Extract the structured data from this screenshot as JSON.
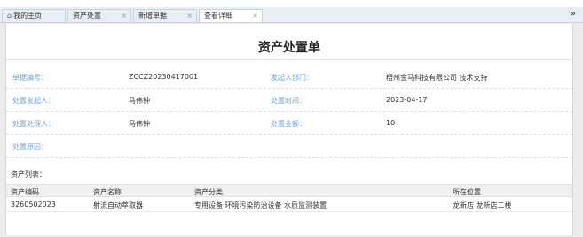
{
  "tabs": [
    {
      "label": "我的主页",
      "icon": "home-icon",
      "closable": false,
      "active": false
    },
    {
      "label": "资产处置",
      "closable": true,
      "active": false
    },
    {
      "label": "新增单据",
      "closable": true,
      "active": false
    },
    {
      "label": "查看详细",
      "closable": true,
      "active": true
    }
  ],
  "tab_close_glyph": "×",
  "more_glyph": "»",
  "form": {
    "title": "资产处置单",
    "rows": [
      {
        "l1": "单据编号：",
        "v1": "ZCCZ20230417001",
        "l2": "发起人部门：",
        "v2": "梧州金马科技有限公司 技术支持"
      },
      {
        "l1": "处置发起人：",
        "v1": "马伟钟",
        "l2": "处置时间：",
        "v2": "2023-04-17"
      },
      {
        "l1": "处置处理人：",
        "v1": "马伟钟",
        "l2": "处置金额：",
        "v2": "10"
      },
      {
        "l1": "处置原因：",
        "v1": "",
        "l2": "",
        "v2": ""
      }
    ]
  },
  "asset_list": {
    "title": "资产列表：",
    "columns": [
      "资产编码",
      "资产名称",
      "资产分类",
      "所在位置"
    ],
    "rows": [
      [
        "3260502023",
        "射流自动萃取器",
        "专用设备 环境污染防治设备 水质监测装置",
        "龙新店 龙新店二楼"
      ]
    ]
  },
  "colors": {
    "label": "#6ea2d6",
    "tabbar": "#e9eef5"
  }
}
